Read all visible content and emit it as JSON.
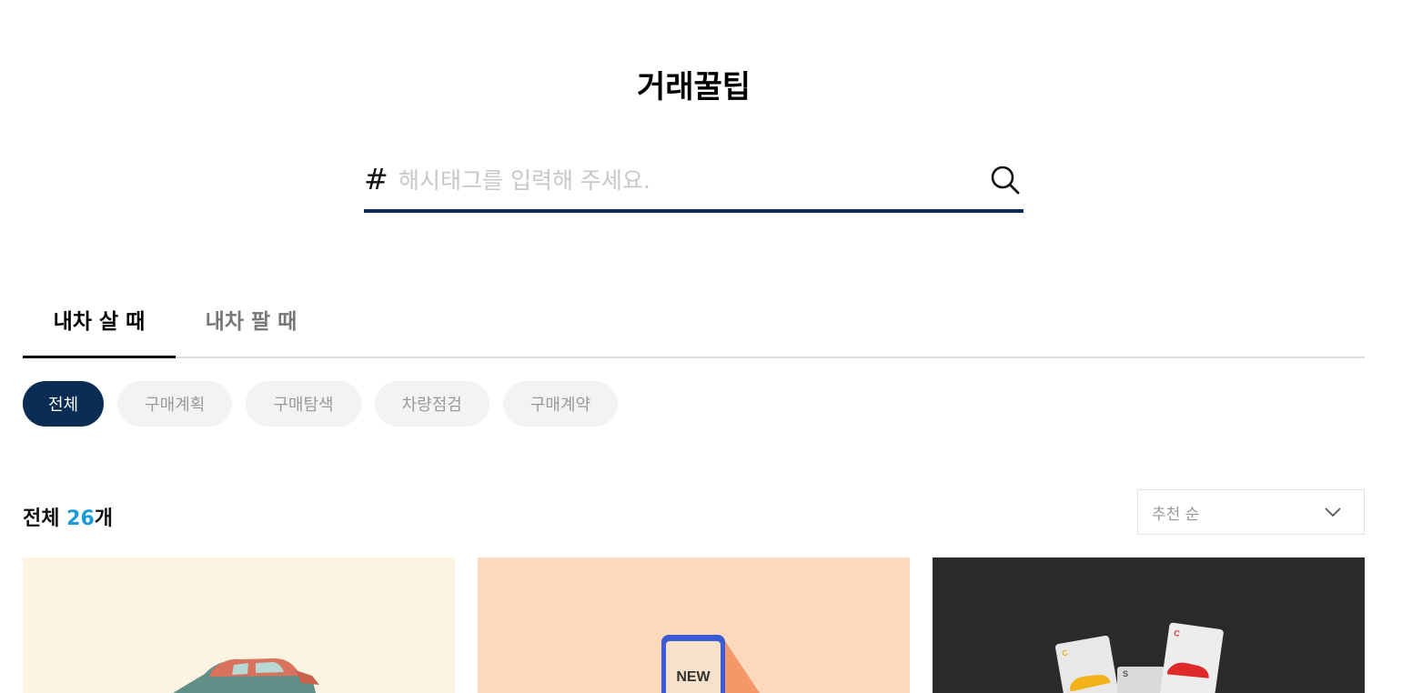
{
  "page": {
    "title": "거래꿀팁"
  },
  "search": {
    "hash_symbol": "#",
    "placeholder": "해시태그를 입력해 주세요."
  },
  "tabs": [
    {
      "label": "내차 살 때",
      "active": true
    },
    {
      "label": "내차 팔 때",
      "active": false
    }
  ],
  "filters": [
    {
      "label": "전체",
      "active": true
    },
    {
      "label": "구매계획",
      "active": false
    },
    {
      "label": "구매탐색",
      "active": false
    },
    {
      "label": "차량점검",
      "active": false
    },
    {
      "label": "구매계약",
      "active": false
    }
  ],
  "result": {
    "prefix": "전체 ",
    "count": "26",
    "suffix": "개"
  },
  "sort": {
    "selected": "추천 순"
  },
  "cards": [
    {
      "illustration": "car-illustration"
    },
    {
      "illustration": "new-phone-illustration",
      "badge": "NEW"
    },
    {
      "illustration": "car-cards-illustration",
      "card_letters": [
        "C",
        "C",
        "S"
      ]
    }
  ],
  "colors": {
    "accent_navy": "#0b2d55",
    "count_blue": "#1a9ad6",
    "chip_inactive_bg": "#f3f3f3",
    "card1_bg": "#fbf4e3",
    "card2_bg": "#fcd9bc",
    "card3_bg": "#2a2a2a"
  },
  "icons": {
    "search": "search-icon",
    "sort": "chevron-down-icon"
  }
}
